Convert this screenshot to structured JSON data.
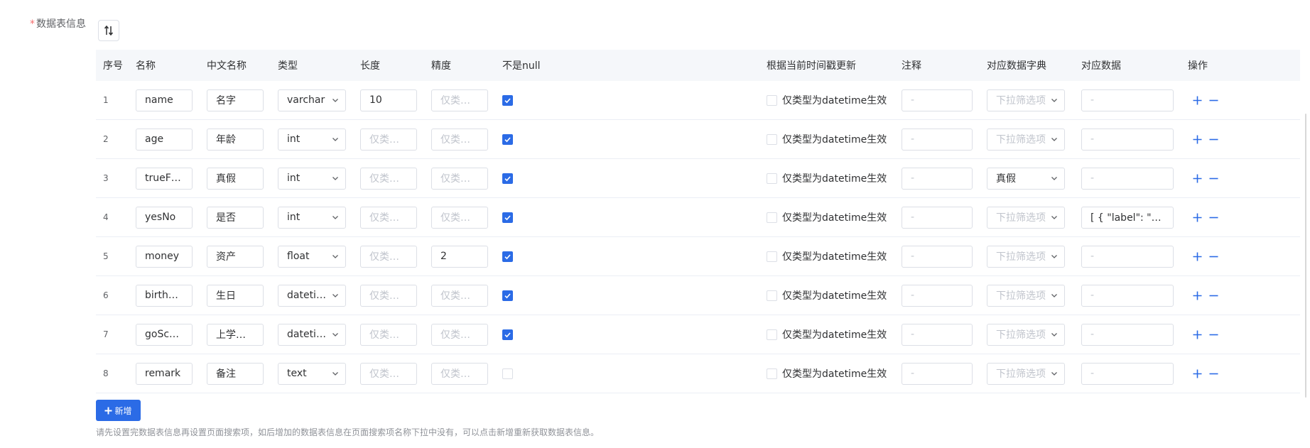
{
  "form": {
    "required_mark": "*",
    "label": "数据表信息"
  },
  "table": {
    "headers": {
      "seq": "序号",
      "name": "名称",
      "cn_name": "中文名称",
      "type": "类型",
      "length": "长度",
      "precision": "精度",
      "not_null": "不是null",
      "timestamp": "根据当前时间戳更新",
      "comment": "注释",
      "dict": "对应数据字典",
      "data": "对应数据",
      "op": "操作"
    },
    "placeholders": {
      "only_type": "仅类型为",
      "timestamp_label": "仅类型为datetime生效",
      "comment": "-",
      "dict": "下拉筛选项",
      "data": "-"
    },
    "rows": [
      {
        "seq": "1",
        "name": "name",
        "cn": "名字",
        "type": "varchar",
        "length": "10",
        "precision": "",
        "not_null": true,
        "ts": false,
        "comment": "",
        "dict": "",
        "data": ""
      },
      {
        "seq": "2",
        "name": "age",
        "cn": "年龄",
        "type": "int",
        "length": "",
        "precision": "",
        "not_null": true,
        "ts": false,
        "comment": "",
        "dict": "",
        "data": ""
      },
      {
        "seq": "3",
        "name": "trueF…",
        "cn": "真假",
        "type": "int",
        "length": "",
        "precision": "",
        "not_null": true,
        "ts": false,
        "comment": "",
        "dict": "真假",
        "data": ""
      },
      {
        "seq": "4",
        "name": "yesNo",
        "cn": "是否",
        "type": "int",
        "length": "",
        "precision": "",
        "not_null": true,
        "ts": false,
        "comment": "",
        "dict": "",
        "data": "[ { \"label\": \"否\"…"
      },
      {
        "seq": "5",
        "name": "money",
        "cn": "资产",
        "type": "float",
        "length": "",
        "precision": "2",
        "not_null": true,
        "ts": false,
        "comment": "",
        "dict": "",
        "data": ""
      },
      {
        "seq": "6",
        "name": "birthday",
        "cn": "生日",
        "type": "datetime",
        "length": "",
        "precision": "",
        "not_null": true,
        "ts": false,
        "comment": "",
        "dict": "",
        "data": ""
      },
      {
        "seq": "7",
        "name": "goSch…",
        "cn": "上学…",
        "type": "datetime",
        "length": "",
        "precision": "",
        "not_null": true,
        "ts": false,
        "comment": "",
        "dict": "",
        "data": ""
      },
      {
        "seq": "8",
        "name": "remark",
        "cn": "备注",
        "type": "text",
        "length": "",
        "precision": "",
        "not_null": false,
        "ts": false,
        "comment": "",
        "dict": "",
        "data": ""
      }
    ]
  },
  "actions": {
    "add_label": "新增"
  },
  "hint": "请先设置完数据表信息再设置页面搜索项，如后增加的数据表信息在页面搜索项名称下拉中没有，可以点击新增重新获取数据表信息。",
  "colors": {
    "primary": "#2b6be6",
    "border": "#dcdfe6",
    "placeholder": "#c0c4cc",
    "header_bg": "#f5f7fa",
    "required": "#f56c6c"
  },
  "icons": {
    "sort": "sort-icon",
    "checkbox_checked": "check-icon",
    "select": "chevron-down-icon",
    "add_row": "plus-icon",
    "remove_row": "minus-icon"
  }
}
